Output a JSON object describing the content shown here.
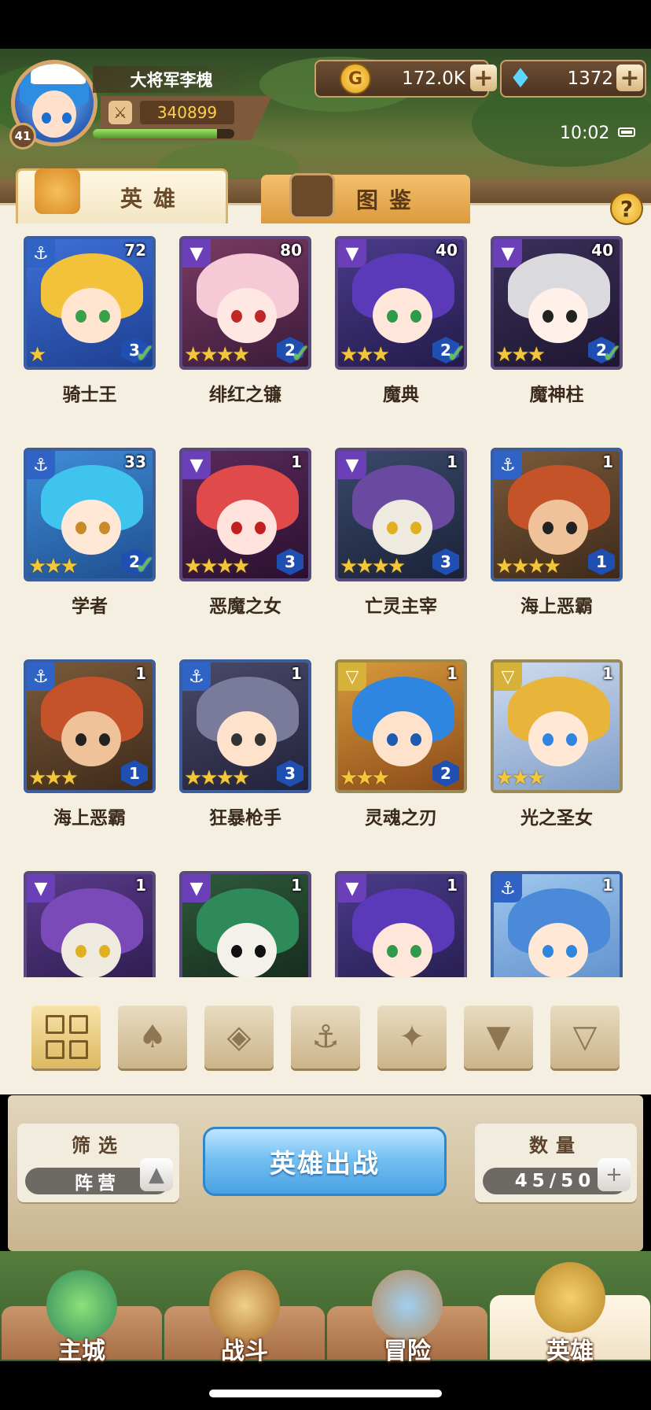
{
  "player": {
    "name": "大将军李槐",
    "level": "41",
    "power": "340899",
    "xp_fraction": 0.88
  },
  "resources": {
    "gold": "172.0K",
    "gems": "1372",
    "plus": "+"
  },
  "status": {
    "time": "10:02"
  },
  "tabs": {
    "heroes": "英雄",
    "dex": "图鉴",
    "help": "?"
  },
  "heroes": [
    {
      "name": "骑士王",
      "level": "72",
      "faction": "anchor",
      "stars": "★",
      "rarity": "3",
      "check": "✓"
    },
    {
      "name": "绯红之镰",
      "level": "80",
      "faction": "demon",
      "stars": "★★★★",
      "rarity": "2",
      "check": "✓"
    },
    {
      "name": "魔典",
      "level": "40",
      "faction": "demon",
      "stars": "★★★",
      "rarity": "2",
      "check": "✓"
    },
    {
      "name": "魔神柱",
      "level": "40",
      "faction": "demon",
      "stars": "★★★",
      "rarity": "2",
      "check": "✓"
    },
    {
      "name": "学者",
      "level": "33",
      "faction": "anchor",
      "stars": "★★★",
      "rarity": "2",
      "check": "✓"
    },
    {
      "name": "恶魔之女",
      "level": "1",
      "faction": "demon",
      "stars": "★★★★",
      "rarity": "3",
      "check": ""
    },
    {
      "name": "亡灵主宰",
      "level": "1",
      "faction": "demon",
      "stars": "★★★★",
      "rarity": "3",
      "check": ""
    },
    {
      "name": "海上恶霸",
      "level": "1",
      "faction": "anchor",
      "stars": "★★★★",
      "rarity": "1",
      "check": ""
    },
    {
      "name": "海上恶霸",
      "level": "1",
      "faction": "anchor",
      "stars": "★★★",
      "rarity": "1",
      "check": ""
    },
    {
      "name": "狂暴枪手",
      "level": "1",
      "faction": "anchor",
      "stars": "★★★★",
      "rarity": "3",
      "check": ""
    },
    {
      "name": "灵魂之刃",
      "level": "1",
      "faction": "holy",
      "stars": "★★★",
      "rarity": "2",
      "check": ""
    },
    {
      "name": "光之圣女",
      "level": "1",
      "faction": "holy",
      "stars": "★★★",
      "rarity": "",
      "check": ""
    },
    {
      "name": "",
      "level": "1",
      "faction": "demon",
      "stars": "",
      "rarity": "",
      "check": ""
    },
    {
      "name": "",
      "level": "1",
      "faction": "demon",
      "stars": "",
      "rarity": "",
      "check": ""
    },
    {
      "name": "",
      "level": "1",
      "faction": "demon",
      "stars": "",
      "rarity": "",
      "check": ""
    },
    {
      "name": "",
      "level": "1",
      "faction": "anchor",
      "stars": "",
      "rarity": "",
      "check": ""
    }
  ],
  "filter_icons": [
    "all-grid-icon",
    "forest-faction-icon",
    "shield-faction-icon",
    "anchor-faction-icon",
    "beast-faction-icon",
    "demon-faction-icon",
    "holy-faction-icon"
  ],
  "filter": {
    "title": "筛选",
    "value": "阵营",
    "toggle": "▲"
  },
  "deploy": {
    "label": "英雄出战"
  },
  "count": {
    "title": "数量",
    "value": "45/50",
    "plus": "+"
  },
  "nav": [
    {
      "label": "主城"
    },
    {
      "label": "战斗"
    },
    {
      "label": "冒险"
    },
    {
      "label": "英雄"
    }
  ],
  "colors": {
    "anchor": "#2f63c6",
    "demon": "#6a3fb8",
    "holy": "#d6b23a",
    "deploy": "#4aa1e3",
    "parchment": "#f5efe2"
  }
}
